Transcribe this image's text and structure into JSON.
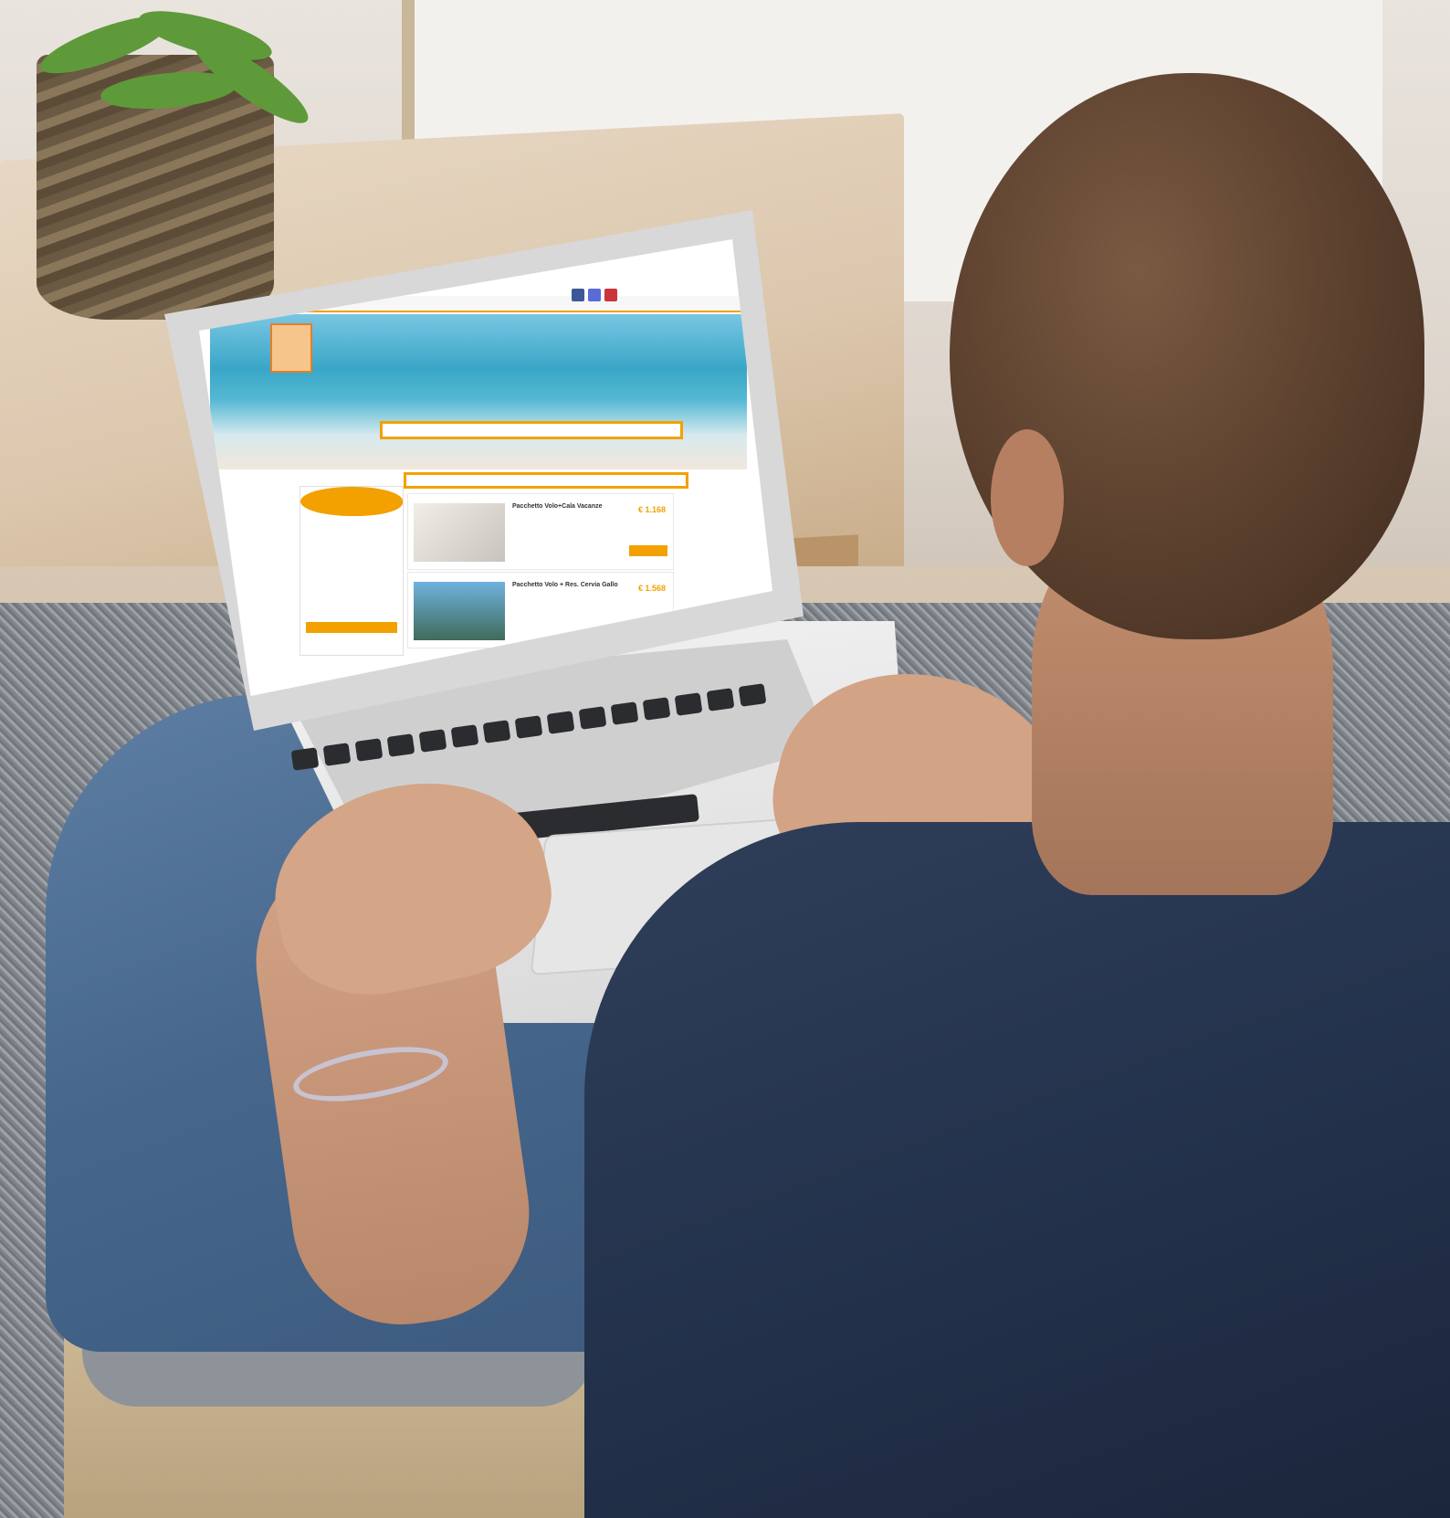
{
  "screen_site": {
    "card_1": {
      "title": "Pacchetto Volo+Cala Vacanze",
      "price": "€ 1.168"
    },
    "card_2": {
      "title": "Pacchetto Volo + Res. Cervia Gallo",
      "price": "€ 1.568"
    }
  },
  "colors": {
    "site_orange": "#f2a100",
    "shirt_navy": "#22304a",
    "jeans_blue": "#46668c"
  }
}
